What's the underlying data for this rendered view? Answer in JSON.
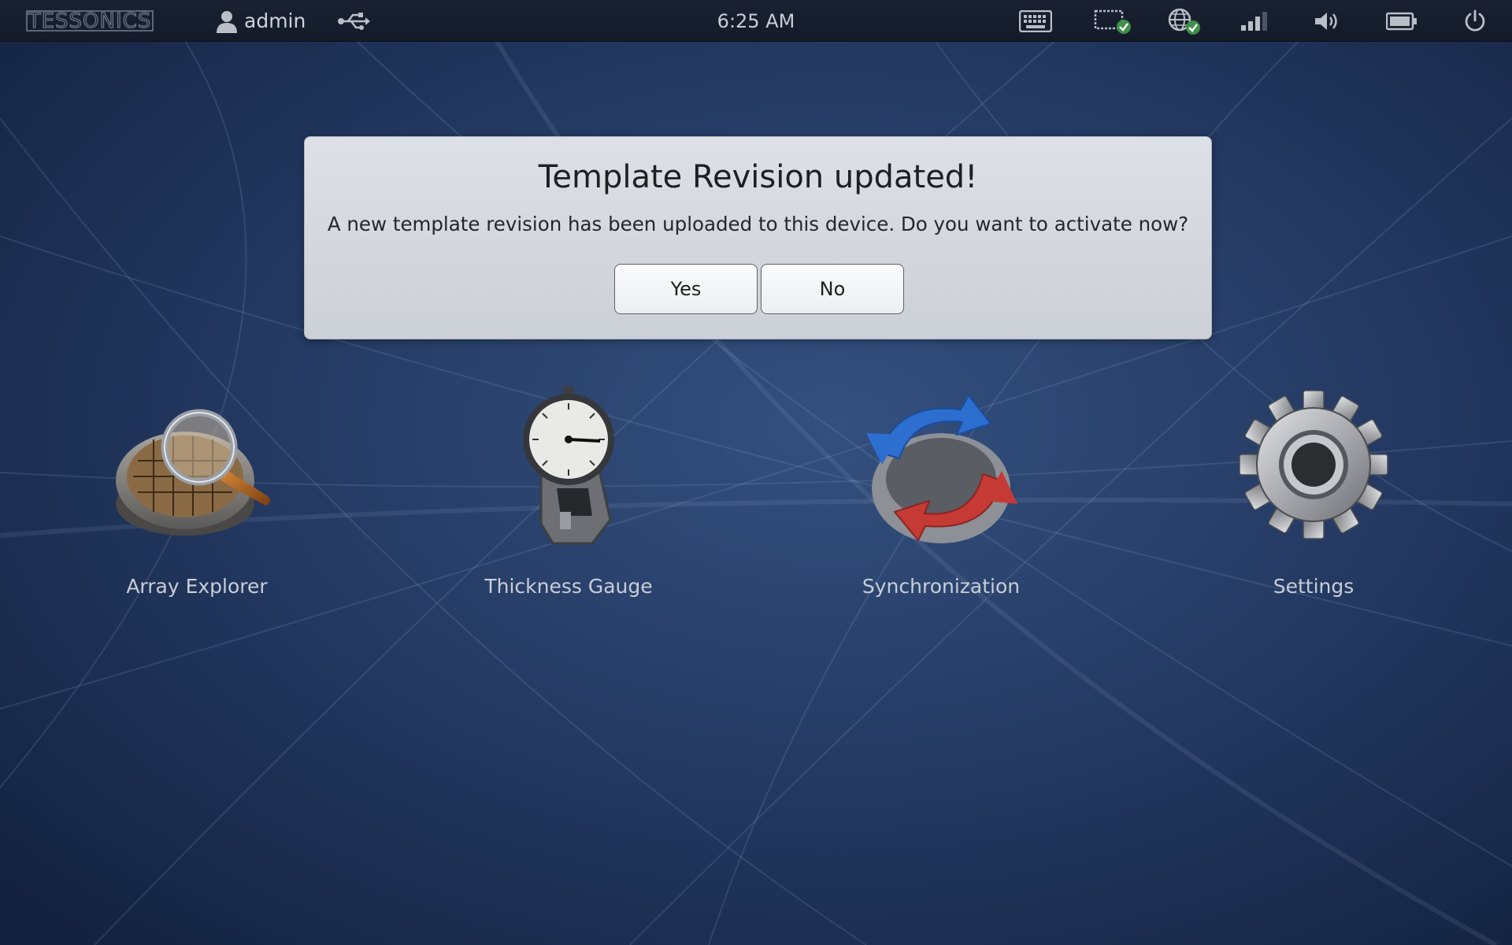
{
  "topbar": {
    "logo_text": "TESSONICS",
    "user": "admin",
    "time": "6:25 AM",
    "icons": [
      "user-icon",
      "usb-icon",
      "keyboard-icon",
      "display-check-icon",
      "network-globe-icon",
      "signal-icon",
      "volume-icon",
      "battery-icon",
      "power-icon"
    ]
  },
  "dialog": {
    "title": "Template Revision updated!",
    "message": "A new template revision has been uploaded to this device. Do you want to activate now?",
    "yes_label": "Yes",
    "no_label": "No"
  },
  "apps": [
    {
      "label": "Array Explorer",
      "icon": "array-explorer-icon"
    },
    {
      "label": "Thickness Gauge",
      "icon": "thickness-gauge-icon"
    },
    {
      "label": "Synchronization",
      "icon": "synchronization-icon"
    },
    {
      "label": "Settings",
      "icon": "gear-icon"
    }
  ],
  "colors": {
    "desktop_background": "#1e3157",
    "topbar": "#161d2c",
    "dialog_background": "#d5d8de",
    "sync_blue": "#2c6fd0",
    "sync_red": "#c63a36"
  }
}
